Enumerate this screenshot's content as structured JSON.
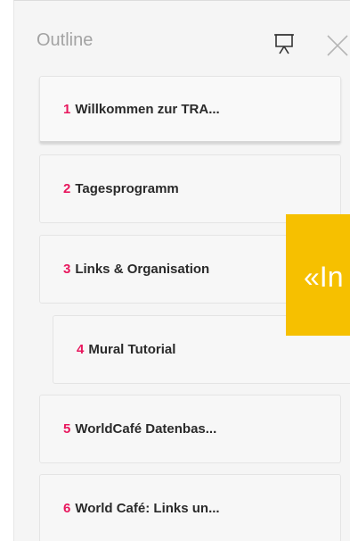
{
  "outline": {
    "title": "Outline",
    "items": [
      {
        "number": "1",
        "label": "Willkommen zur TRA..."
      },
      {
        "number": "2",
        "label": "Tagesprogramm"
      },
      {
        "number": "3",
        "label": "Links & Organisation"
      },
      {
        "number": "4",
        "label": "Mural Tutorial"
      },
      {
        "number": "5",
        "label": "WorldCafé Datenbas..."
      },
      {
        "number": "6",
        "label": "World Café: Links un..."
      }
    ]
  },
  "overlay": {
    "text": "«In"
  },
  "icons": {
    "present": "presentation-icon",
    "close": "close-icon"
  },
  "colors": {
    "accent_number": "#e8175d",
    "overlay_bg": "#f6c000"
  }
}
